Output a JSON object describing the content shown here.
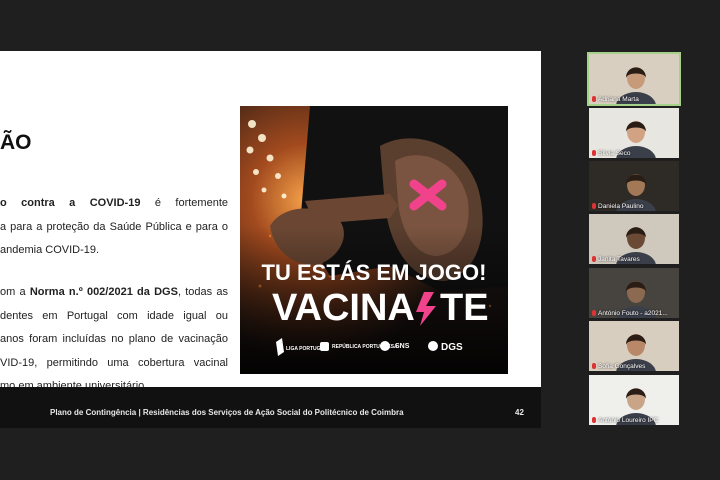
{
  "slide": {
    "title": "ÃO",
    "paragraph1": [
      [
        "o contra a COVID-19",
        " é fortemente"
      ],
      [
        "a para a proteção da Saúde Pública e para o"
      ],
      [
        "andemia COVID-19."
      ]
    ],
    "paragraph2": [
      [
        "om a ",
        "Norma n.º 002/2021 da DGS",
        ", todas as"
      ],
      [
        "dentes em Portugal com idade igual ou"
      ],
      [
        " anos foram incluídas no plano de vacinação"
      ],
      [
        "VID-19, permitindo uma cobertura vacinal"
      ],
      [
        "mo em ambiente universitário."
      ]
    ],
    "poster": {
      "headline1": "TU ESTÁS EM JOGO!",
      "headline2": "VACINA",
      "headline3": "TE",
      "logos": [
        "LIGA PORTUGAL",
        "REPÚBLICA PORTUGUESA",
        "SNS",
        "DGS"
      ]
    },
    "footer_text": "Plano de Contingência | Residências dos Serviços de Ação Social do Politécnico de Coimbra",
    "page_number": "42"
  },
  "participants": [
    {
      "name": "Adriana Marta",
      "active": true,
      "skin": "#c79a7a",
      "bg": "#d9cfc0"
    },
    {
      "name": "Sílvia Seco",
      "active": false,
      "skin": "#d1a283",
      "bg": "#e8e6e0"
    },
    {
      "name": "Daniela Paulino",
      "active": false,
      "skin": "#a37857",
      "bg": "#2e2a26"
    },
    {
      "name": "Janita Tavares",
      "active": false,
      "skin": "#6b4a35",
      "bg": "#cfc8bd"
    },
    {
      "name": "António Fouto - a2021...",
      "active": false,
      "skin": "#8c6a52",
      "bg": "#474440"
    },
    {
      "name": "Sofia Gonçalves",
      "active": false,
      "skin": "#b88868",
      "bg": "#d8cebf"
    },
    {
      "name": "António Loureiro IPC",
      "active": false,
      "skin": "#c9a587",
      "bg": "#efefec"
    }
  ],
  "colors": {
    "pink_accent": "#f0438c",
    "active_outline": "#a6d18b"
  }
}
